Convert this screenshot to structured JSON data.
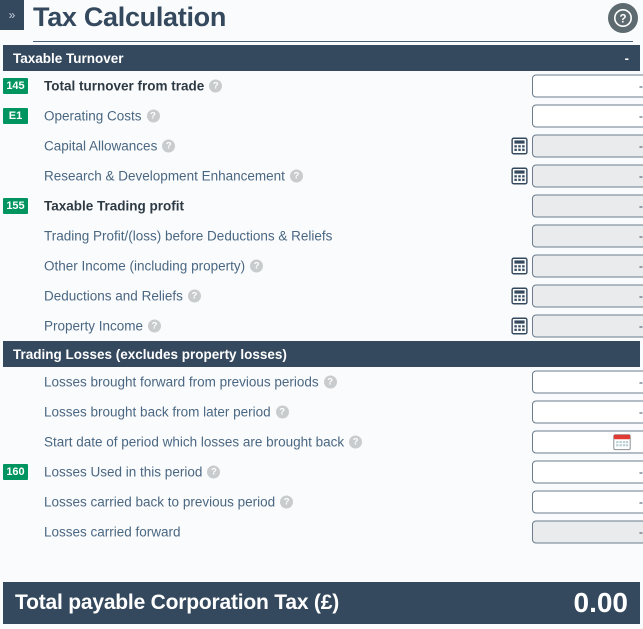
{
  "topbar": {
    "collapse_label": "»",
    "title": "Tax Calculation",
    "help_icon": "question-mark-circle-icon"
  },
  "sections": [
    {
      "title": "Taxable Turnover",
      "collapse_marker": "-",
      "rows": [
        {
          "badge": "145",
          "label": "Total turnover from trade",
          "help": "?",
          "strong": true,
          "calc": false,
          "value": "-",
          "disabled": false,
          "date": false
        },
        {
          "badge": "E1",
          "label": "Operating Costs",
          "help": "?",
          "strong": false,
          "calc": false,
          "value": "-",
          "disabled": false,
          "date": false
        },
        {
          "badge": "",
          "label": "Capital Allowances",
          "help": "?",
          "strong": false,
          "calc": true,
          "value": "-",
          "disabled": true,
          "date": false
        },
        {
          "badge": "",
          "label": "Research & Development Enhancement",
          "help": "?",
          "strong": false,
          "calc": true,
          "value": "-",
          "disabled": true,
          "date": false
        },
        {
          "badge": "155",
          "label": "Taxable Trading profit",
          "help": "",
          "strong": true,
          "calc": false,
          "value": "-",
          "disabled": true,
          "date": false
        },
        {
          "badge": "",
          "label": "Trading Profit/(loss) before Deductions & Reliefs",
          "help": "",
          "strong": false,
          "calc": false,
          "value": "-",
          "disabled": true,
          "date": false
        },
        {
          "badge": "",
          "label": "Other Income (including property)",
          "help": "?",
          "strong": false,
          "calc": true,
          "value": "-",
          "disabled": true,
          "date": false
        },
        {
          "badge": "",
          "label": "Deductions and Reliefs",
          "help": "?",
          "strong": false,
          "calc": true,
          "value": "-",
          "disabled": true,
          "date": false
        },
        {
          "badge": "",
          "label": "Property Income",
          "help": "?",
          "strong": false,
          "calc": true,
          "value": "-",
          "disabled": true,
          "date": false
        }
      ]
    },
    {
      "title": "Trading Losses (excludes property losses)",
      "collapse_marker": "",
      "rows": [
        {
          "badge": "",
          "label": "Losses brought forward from previous periods",
          "help": "?",
          "strong": false,
          "calc": false,
          "value": "-",
          "disabled": false,
          "date": false
        },
        {
          "badge": "",
          "label": "Losses brought back from later period",
          "help": "?",
          "strong": false,
          "calc": false,
          "value": "-",
          "disabled": false,
          "date": false
        },
        {
          "badge": "",
          "label": "Start date of period which losses are brought back",
          "help": "?",
          "strong": false,
          "calc": false,
          "value": "",
          "disabled": false,
          "date": true
        },
        {
          "badge": "160",
          "label": "Losses Used in this period",
          "help": "?",
          "strong": false,
          "calc": false,
          "value": "-",
          "disabled": false,
          "date": false
        },
        {
          "badge": "",
          "label": "Losses carried back to previous period",
          "help": "?",
          "strong": false,
          "calc": false,
          "value": "-",
          "disabled": false,
          "date": false
        },
        {
          "badge": "",
          "label": "Losses carried forward",
          "help": "",
          "strong": false,
          "calc": false,
          "value": "-",
          "disabled": true,
          "date": false
        }
      ]
    }
  ],
  "total": {
    "label": "Total payable Corporation Tax (£)",
    "value": "0.00"
  },
  "colors": {
    "header_navy": "#34495e",
    "badge_green": "#009460",
    "label_blue": "#4a6782",
    "page_bg": "#fafbfc",
    "disabled_field": "#e9ebec"
  }
}
